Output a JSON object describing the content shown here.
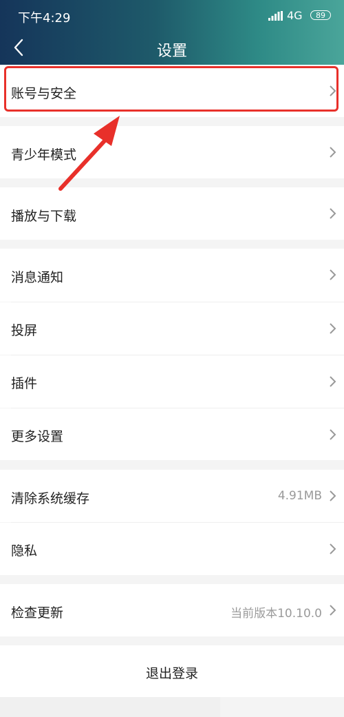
{
  "status_bar": {
    "time": "下午4:29",
    "network": "4G",
    "battery": "89"
  },
  "header": {
    "title": "设置"
  },
  "rows": [
    {
      "label": "账号与安全"
    },
    {
      "label": "青少年模式"
    },
    {
      "label": "播放与下载"
    },
    {
      "label": "消息通知"
    },
    {
      "label": "投屏"
    },
    {
      "label": "插件"
    },
    {
      "label": "更多设置"
    },
    {
      "label": "清除系统缓存",
      "value": "4.91MB"
    },
    {
      "label": "隐私"
    },
    {
      "label": "检查更新",
      "value": "当前版本10.10.0"
    }
  ],
  "logout": {
    "label": "退出登录"
  },
  "colors": {
    "accent": "#e8302a",
    "header_start": "#15355a",
    "header_end": "#4aa59a"
  }
}
